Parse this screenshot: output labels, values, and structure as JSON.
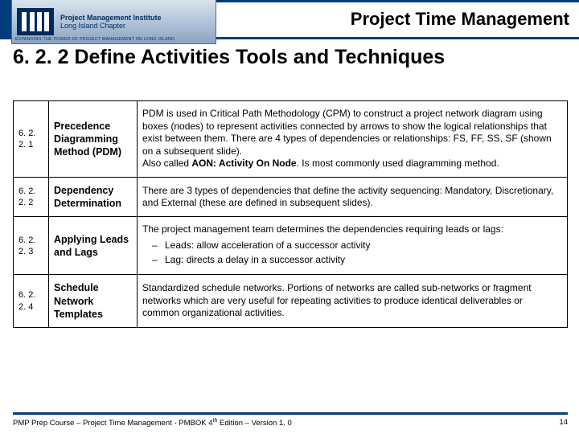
{
  "brand": {
    "org_line1": "Project Management Institute",
    "org_line2": "Long Island Chapter",
    "tagline": "EXPANDING THE POWER OF PROJECT MANAGEMENT ON LONG ISLAND"
  },
  "header": {
    "title": "Project Time Management"
  },
  "section": {
    "title": "6. 2. 2 Define Activities Tools and Techniques"
  },
  "rows": [
    {
      "num": "6. 2. 2. 1",
      "name": "Precedence Diagramming Method (PDM)",
      "desc_html": "PDM is used in Critical Path Methodology (CPM) to construct a project network diagram using boxes (nodes) to represent activities connected by arrows to show the logical relationships that exist between them.  There are 4 types of dependencies or relationships: FS, FF, SS, SF (shown on a subsequent slide).<br>Also called <b>AON: Activity On Node</b>.  Is most commonly used diagramming method."
    },
    {
      "num": "6. 2. 2. 2",
      "name": "Dependency Determination",
      "desc_html": "There are 3 types of dependencies that define the activity sequencing: Mandatory, Discretionary, and External (these are defined in subsequent slides)."
    },
    {
      "num": "6. 2. 2. 3",
      "name": "Applying Leads and Lags",
      "desc_html": "The project management team determines the dependencies requiring leads or lags:<ul><li>Leads: allow acceleration of a successor activity</li><li>Lag: directs a delay in a successor activity</li></ul>"
    },
    {
      "num": "6. 2. 2. 4",
      "name": "Schedule Network Templates",
      "desc_html": "Standardized schedule networks.  Portions of networks are called sub-networks or fragment networks which are very useful for repeating activities to produce identical deliverables or common organizational activities."
    }
  ],
  "footer": {
    "left_pre": "PMP Prep Course – Project Time Management - PMBOK 4",
    "left_sup": "th",
    "left_post": " Edition – Version 1. 0",
    "page": "14"
  }
}
